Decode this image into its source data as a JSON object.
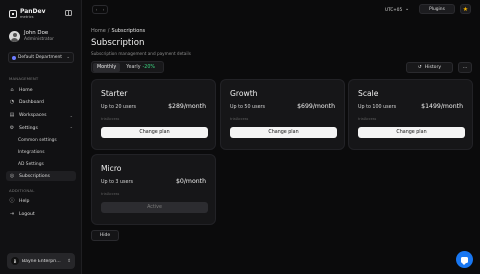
{
  "sidebar": {
    "logo": {
      "name": "PanDev",
      "sub": "metrics"
    },
    "user": {
      "name": "John Doe",
      "role": "Administrator"
    },
    "department": "Default Department",
    "section_management": "MANAGEMENT",
    "section_additional": "ADDITIONAL",
    "items": {
      "home": "Home",
      "dashboard": "Dashboard",
      "workspaces": "Workspaces",
      "settings": "Settings",
      "common_settings": "Common settings",
      "integrations": "Integrations",
      "ad_settings": "AD Settings",
      "subscriptions": "Subscriptions",
      "help": "Help",
      "logout": "Logout"
    },
    "company": {
      "initial": "B",
      "name": "Bayne Enterpri..."
    }
  },
  "topbar": {
    "timezone": "UTC+05",
    "plugins": "Plugins"
  },
  "breadcrumb": {
    "home": "Home",
    "separator": "/",
    "current": "Subscriptions"
  },
  "page": {
    "title": "Subscription",
    "subtitle": "Subscription management and payment details"
  },
  "billing_toggle": {
    "monthly": "Monthly",
    "yearly": "Yearly",
    "discount": "-20%",
    "selected": "Monthly"
  },
  "history_label": "History",
  "more_label": "···",
  "plans": [
    {
      "name": "Starter",
      "users": "Up to 20 users",
      "price": "$289/month",
      "note": "trialAccess",
      "button": "Change plan",
      "active": false
    },
    {
      "name": "Growth",
      "users": "Up to 50 users",
      "price": "$699/month",
      "note": "trialAccess",
      "button": "Change plan",
      "active": false
    },
    {
      "name": "Scale",
      "users": "Up to 100 users",
      "price": "$1499/month",
      "note": "trialAccess",
      "button": "Change plan",
      "active": false
    },
    {
      "name": "Micro",
      "users": "Up to 3 users",
      "price": "$0/month",
      "note": "trialAccess",
      "button": "Active",
      "active": true
    }
  ],
  "hide_label": "Hide",
  "colors": {
    "accent_green": "#3ddc84",
    "chat_blue": "#1877f2",
    "star": "#f5b400"
  }
}
